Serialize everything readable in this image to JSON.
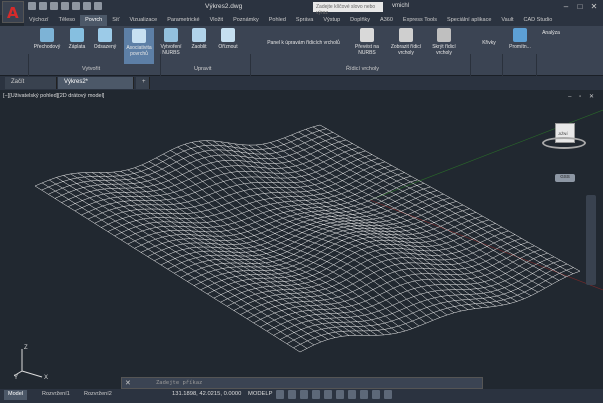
{
  "title_bar": {
    "app_logo": "A",
    "document_title": "Výkres2.dwg",
    "search_placeholder": "Zadejte klíčové slovo nebo výraz",
    "user_name": "vmichl"
  },
  "ribbon_tabs": [
    "Výchozí",
    "Těleso",
    "Povrch",
    "Síť",
    "Vizualizace",
    "Parametrické",
    "Vložit",
    "Poznámky",
    "Pohled",
    "Správa",
    "Výstup",
    "Doplňky",
    "A360",
    "Express Tools",
    "Speciální aplikace",
    "Vault",
    "CAD Studio"
  ],
  "active_tab": "Povrch",
  "ribbon": {
    "create": [
      "Přechodový",
      "Záplata",
      "Odsazený"
    ],
    "associativity": "Asociativita povrchů",
    "nurbs": "Vytvoření NURBS",
    "fillet": "Zaoblit",
    "trim": "Oříznout",
    "cv_panel": "Panel k úpravám řídicích vrcholů",
    "convert": "Převést na NURBS",
    "show_cv": "Zobrazit řídicí vrcholy",
    "hide_cv": "Skrýt řídicí vrcholy",
    "curves": "Křivky",
    "projection": "Promítn...",
    "analysis": "Analýza",
    "panel_labels": {
      "create": "Vytvořit",
      "edit": "Upravit",
      "cv": "Řídicí vrcholy"
    }
  },
  "doc_tabs": [
    "Začít",
    "Výkres2*"
  ],
  "viewport_label": "[−][Uživatelský pohled][2D drátový model]",
  "viewcube": {
    "face": "JIŽNÍ",
    "badge": "GSS"
  },
  "command_line": {
    "placeholder": "Zadejte příkaz"
  },
  "status_bar": {
    "layout_tabs": [
      "Model",
      "Rozvržení1",
      "Rozvržení2"
    ],
    "coordinates": "131.1898, 42.0215, 0.0000",
    "space": "MODELP",
    "scale": "1:1"
  },
  "ucs": {
    "x": "X",
    "y": "Y",
    "z": "Z"
  },
  "colors": {
    "accent": "#4c5868",
    "background": "#212830",
    "wire": "#f0f0f0",
    "logo": "#d52b2b"
  }
}
